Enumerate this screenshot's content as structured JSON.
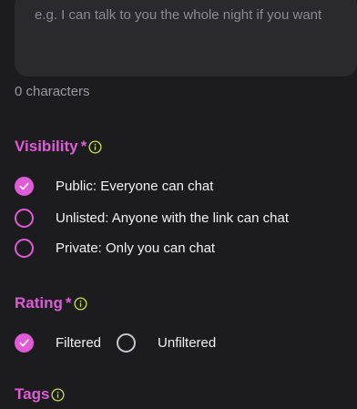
{
  "description": {
    "placeholder": "e.g. I can talk to you the whole night if you want",
    "char_count": "0 characters"
  },
  "visibility": {
    "title": "Visibility",
    "required_mark": "*",
    "options": [
      {
        "label": "Public: Everyone can chat",
        "selected": true
      },
      {
        "label": "Unlisted: Anyone with the link can chat",
        "selected": false
      },
      {
        "label": "Private: Only you can chat",
        "selected": false
      }
    ]
  },
  "rating": {
    "title": "Rating",
    "required_mark": "*",
    "options": [
      {
        "label": "Filtered",
        "selected": true
      },
      {
        "label": "Unfiltered",
        "selected": false
      }
    ]
  },
  "tags": {
    "title": "Tags"
  },
  "colors": {
    "accent": "#e05bd8",
    "info_icon": "#c6e04a",
    "background": "#1c1c1e",
    "input_bg": "#2a2a2d"
  },
  "icons": {
    "info": "info-circle-icon",
    "check": "check-icon"
  }
}
